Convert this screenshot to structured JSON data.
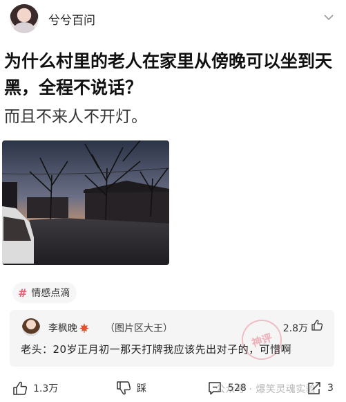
{
  "author": {
    "name": "兮兮百问",
    "avatar_icon": "avatar-girl"
  },
  "post": {
    "question": "为什么村里的老人在家里从傍晚可以坐到天黑，全程不说话？",
    "subtitle": "而且不来人不开灯。",
    "photo_icon": "village-dusk-photo"
  },
  "topic": {
    "hash": "#",
    "label": "情感点滴"
  },
  "comment": {
    "user": "李枫晚",
    "badge": "（图片区大王）",
    "likes": "2.8万",
    "text": "老头：20岁正月初一那天打牌我应该先出对子的，可惜啊",
    "stamp": "神评"
  },
  "actions": {
    "like_count": "1.3万",
    "dislike_label": "踩",
    "comment_count": "528",
    "share_count": "3"
  },
  "watermark": "公众号 · 爆笑灵魂实验",
  "colors": {
    "accent": "#f05a72",
    "comment_bg": "#f5f5f5"
  }
}
